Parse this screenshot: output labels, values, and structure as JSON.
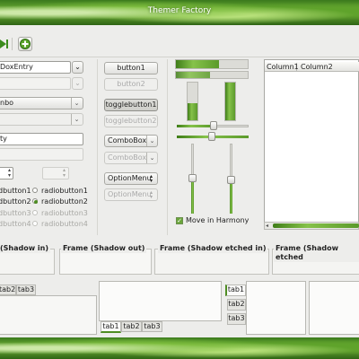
{
  "window": {
    "title": "Themer Factory"
  },
  "combos": {
    "entry1": "DoxEntry",
    "entry2": "",
    "combo1": "nbo",
    "combo2": ""
  },
  "entry": {
    "text": "ty"
  },
  "left_radios": [
    "dbutton1",
    "dbutton2",
    "dbutton3",
    "dbutton4"
  ],
  "radios": [
    {
      "label": "radiobutton1",
      "checked": false,
      "disabled": false
    },
    {
      "label": "radiobutton2",
      "checked": true,
      "disabled": false
    },
    {
      "label": "radiobutton3",
      "checked": false,
      "disabled": true
    },
    {
      "label": "radiobutton4",
      "checked": false,
      "disabled": true
    }
  ],
  "buttons": {
    "button1": "button1",
    "button2": "button2",
    "toggle1": "togglebutton1",
    "toggle2": "togglebutton2",
    "combobox1": "ComboBox",
    "combobox2": "ComboBox",
    "option1": "OptionMenu",
    "option2": "OptionMenu"
  },
  "check": {
    "label": "Move in Harmony",
    "checked": true
  },
  "tree": {
    "columns": [
      "Column1",
      "Column2"
    ]
  },
  "frames": [
    "(Shadow in)",
    "Frame (Shadow out)",
    "Frame (Shadow etched in)",
    "Frame (Shadow etched"
  ],
  "tabs": {
    "top": [
      "tab2",
      "tab3"
    ],
    "bottom": [
      "tab1",
      "tab2",
      "tab3"
    ],
    "left": [
      "tab1",
      "tab2",
      "tab3"
    ]
  },
  "progress": {
    "horizontal": 0.6,
    "vertical_left": 0.45,
    "vertical_right": 1.0
  },
  "colors": {
    "accent": "#4e8d22",
    "leaf": "#6fb035"
  }
}
